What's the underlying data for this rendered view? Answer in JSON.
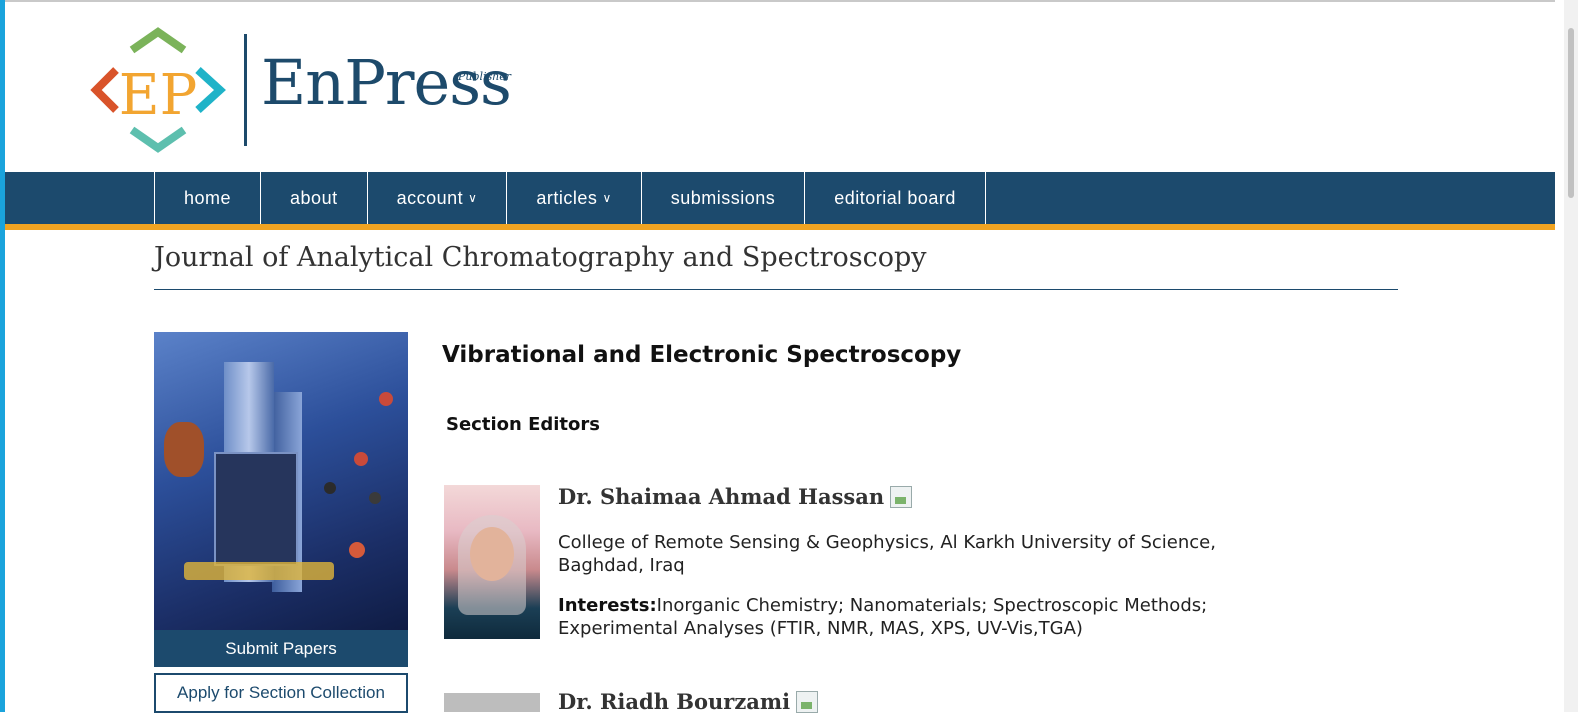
{
  "brand": {
    "name": "EnPress",
    "tagline": "Publisher",
    "colors": {
      "navy": "#1c4a6d",
      "orange": "#f0a321",
      "green": "#7bb35a",
      "red": "#d9532a",
      "teal": "#1fb3c8",
      "gold": "#f2a531"
    }
  },
  "nav": {
    "items": [
      {
        "label": "home",
        "has_dropdown": false
      },
      {
        "label": "about",
        "has_dropdown": false
      },
      {
        "label": "account",
        "has_dropdown": true
      },
      {
        "label": "articles",
        "has_dropdown": true
      },
      {
        "label": "submissions",
        "has_dropdown": false
      },
      {
        "label": "editorial board",
        "has_dropdown": false
      }
    ],
    "dropdown_icon": "chevron-down-icon"
  },
  "journal": {
    "title": "Journal of Analytical Chromatography and Spectroscopy"
  },
  "sidebar": {
    "submit_label": "Submit Papers",
    "apply_label": "Apply for Section Collection"
  },
  "main": {
    "section_title": "Vibrational and Electronic Spectroscopy",
    "editors_heading": "Section Editors",
    "editors": [
      {
        "name": "Dr. Shaimaa Ahmad Hassan",
        "affiliation": "College of Remote Sensing & Geophysics, Al Karkh University of Science, Baghdad, Iraq",
        "interests_label": "Interests:",
        "interests": "Inorganic Chemistry; Nanomaterials; Spectroscopic Methods; Experimental Analyses (FTIR, NMR, MAS, XPS, UV-Vis,TGA)"
      },
      {
        "name": "Dr. Riadh Bourzami"
      }
    ]
  }
}
